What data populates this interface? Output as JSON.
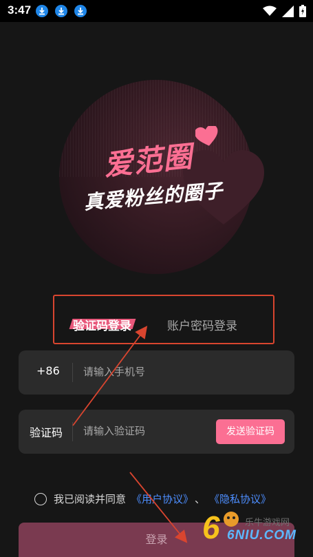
{
  "status_bar": {
    "time": "3:47",
    "icons": [
      "download-icon",
      "download-icon",
      "download-icon",
      "wifi-icon",
      "signal-icon",
      "battery-icon"
    ]
  },
  "hero": {
    "app_name": "爱范圈",
    "slogan": "真爱粉丝的圈子"
  },
  "tabs": {
    "active": "验证码登录",
    "inactive": "账户密码登录"
  },
  "phone_field": {
    "prefix": "+86",
    "placeholder": "请输入手机号"
  },
  "code_field": {
    "label": "验证码",
    "placeholder": "请输入验证码",
    "send_button": "发送验证码"
  },
  "agreement": {
    "text": "我已阅读并同意",
    "user_agreement": "《用户协议》",
    "separator": "、",
    "privacy_policy": "《隐私协议》"
  },
  "login_button": "登录",
  "watermark": {
    "brand": "6NIU.COM",
    "cn": "乐牛游戏网"
  },
  "colors": {
    "accent": "#fb6f93",
    "link": "#4d8eff",
    "annotation": "#d9452f"
  }
}
